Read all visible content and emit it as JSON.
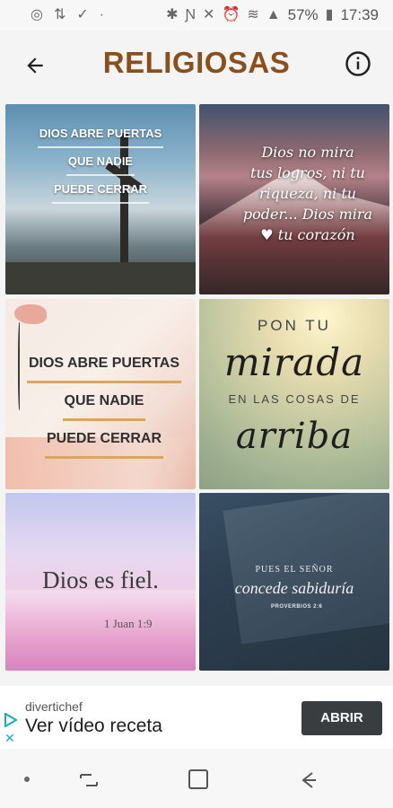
{
  "status_bar": {
    "battery": "57%",
    "time": "17:39",
    "icons": [
      "gps-icon",
      "sync-icon",
      "check-icon",
      "dot-icon",
      "bluetooth-icon",
      "nfc-icon",
      "mute-icon",
      "alarm-icon",
      "wifi-icon",
      "signal-icon",
      "battery-icon"
    ]
  },
  "app_bar": {
    "title": "RELIGIOSAS",
    "title_color": "#8a4f1b",
    "back_icon": "back-arrow-icon",
    "info_icon": "info-icon"
  },
  "tiles": [
    {
      "lines": [
        "DIOS ABRE PUERTAS",
        "QUE NADIE",
        "PUEDE CERRAR"
      ]
    },
    {
      "lines": [
        "Dios no mira",
        "tus logros, ni tu",
        "riqueza, ni tu",
        "poder... Dios mira",
        "♥ tu corazón"
      ]
    },
    {
      "lines": [
        "DIOS ABRE PUERTAS",
        "QUE NADIE",
        "PUEDE CERRAR"
      ]
    },
    {
      "lines": [
        "PON TU",
        "mirada",
        "EN LAS COSAS DE",
        "arriba"
      ]
    },
    {
      "lines": [
        "Dios es fiel.",
        "1 Juan 1:9"
      ]
    },
    {
      "lines": [
        "PUES EL SEÑOR",
        "concede sabiduría",
        "PROVERBIOS 2:6"
      ]
    }
  ],
  "ad": {
    "brand": "divertichef",
    "title": "Ver vídeo receta",
    "cta": "ABRIR"
  }
}
